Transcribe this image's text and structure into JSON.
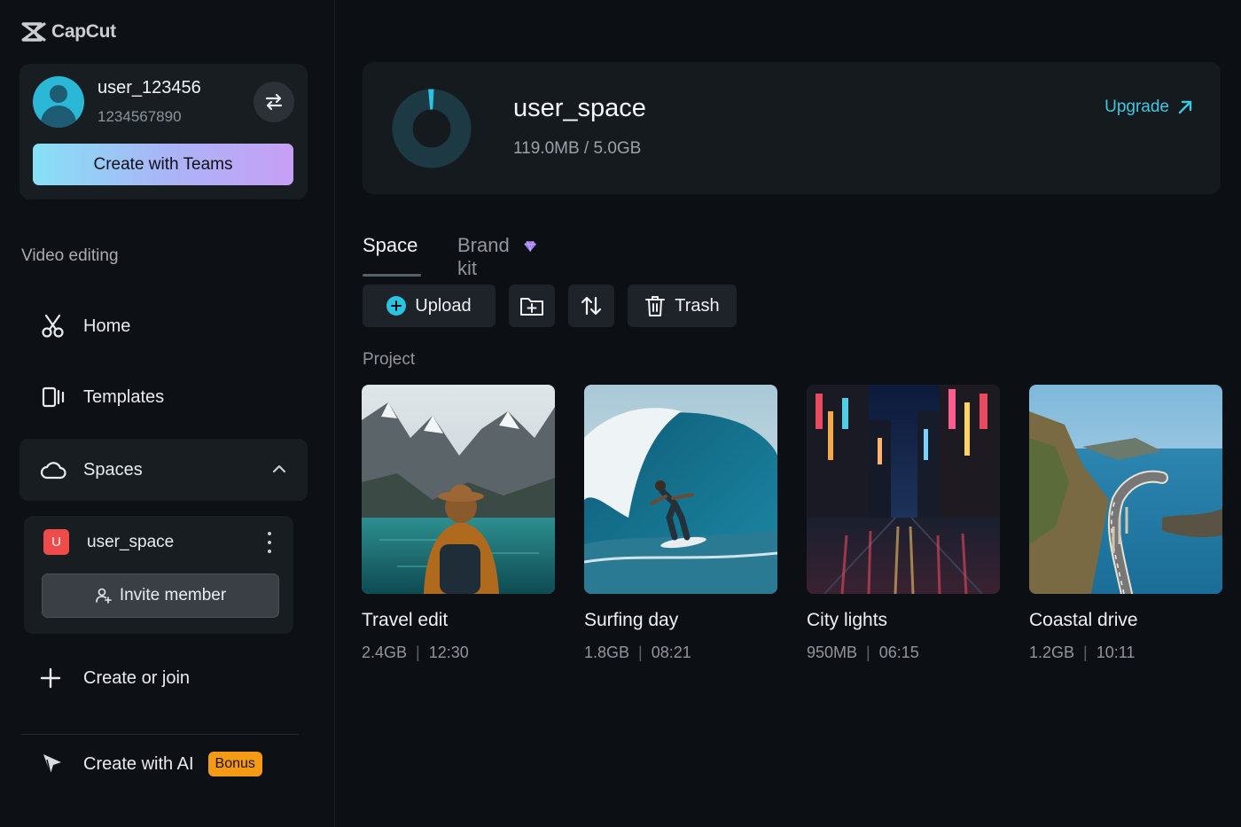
{
  "app": {
    "name": "CapCut"
  },
  "account": {
    "username": "user_123456",
    "user_id": "1234567890",
    "create_teams_label": "Create with Teams"
  },
  "sidebar": {
    "section_label": "Video editing",
    "items": [
      {
        "label": "Home",
        "icon": "scissors-icon"
      },
      {
        "label": "Templates",
        "icon": "template-icon"
      },
      {
        "label": "Spaces",
        "icon": "cloud-icon"
      }
    ],
    "space": {
      "badge": "U",
      "name": "user_space",
      "invite_label": "Invite member"
    },
    "create_join_label": "Create or join",
    "create_ai_label": "Create with AI",
    "bonus_label": "Bonus"
  },
  "storage": {
    "space_name": "user_space",
    "used": "119.0MB",
    "separator": "/",
    "total": "5.0GB",
    "used_fraction": 0.023,
    "upgrade_label": "Upgrade"
  },
  "tabs": [
    {
      "label": "Space",
      "active": true
    },
    {
      "label": "Brand kit",
      "active": false
    }
  ],
  "toolbar": {
    "upload_label": "Upload",
    "trash_label": "Trash"
  },
  "project_label": "Project",
  "projects": [
    {
      "title": "Travel edit",
      "size": "2.4GB",
      "duration": "12:30"
    },
    {
      "title": "Surfing day",
      "size": "1.8GB",
      "duration": "08:21"
    },
    {
      "title": "City lights",
      "size": "950MB",
      "duration": "06:15"
    },
    {
      "title": "Coastal drive",
      "size": "1.2GB",
      "duration": "10:11"
    }
  ],
  "colors": {
    "accent": "#2bc3df",
    "bonus": "#f59a14",
    "badge": "#ef4b4b"
  }
}
